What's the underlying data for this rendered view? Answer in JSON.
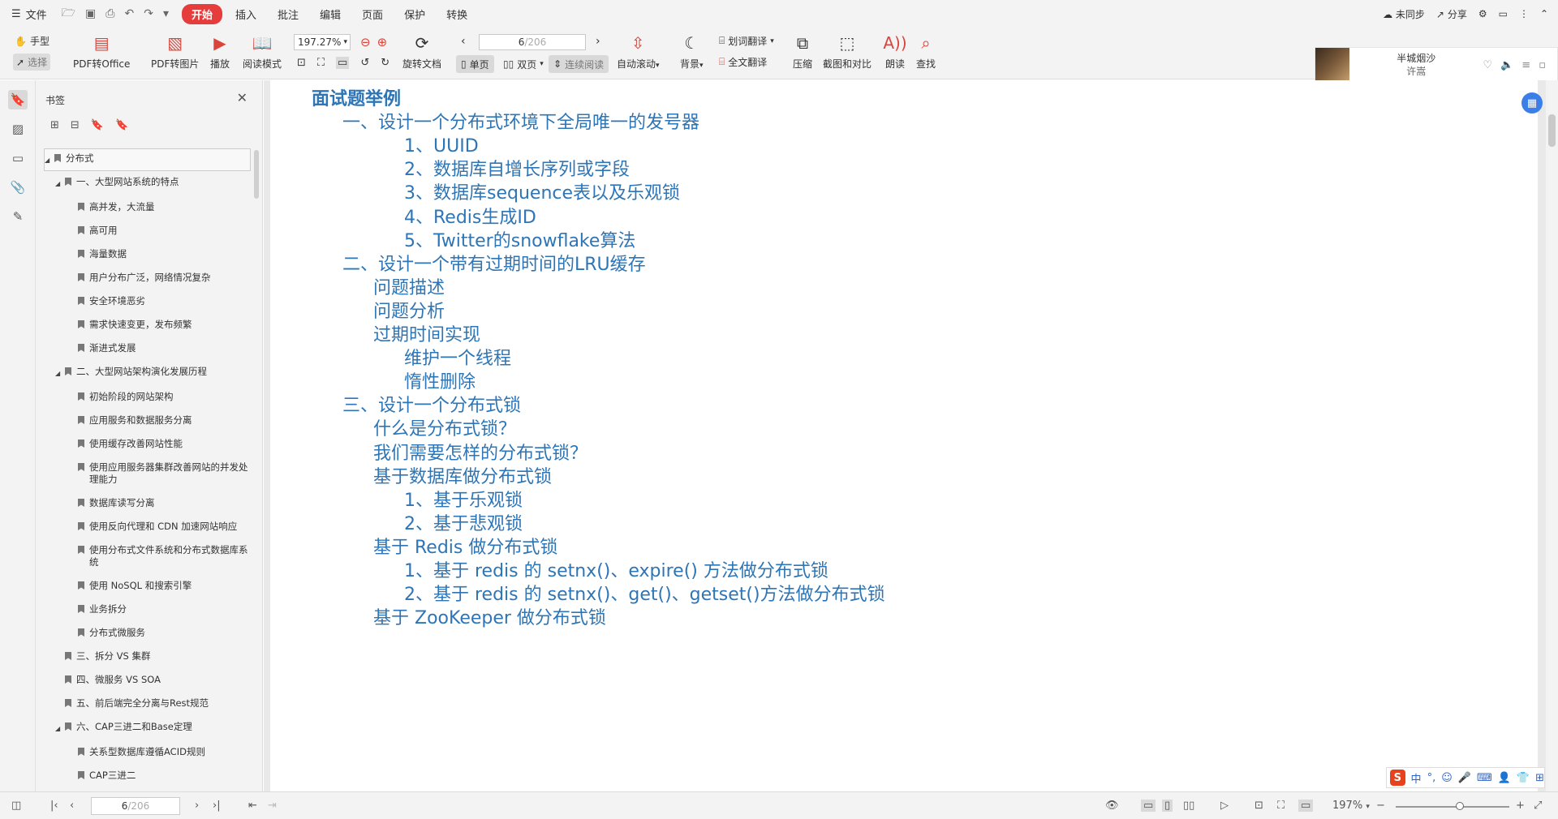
{
  "menubar": {
    "file_label": "文件",
    "tabs": [
      "开始",
      "插入",
      "批注",
      "编辑",
      "页面",
      "保护",
      "转换"
    ],
    "sync_label": "未同步",
    "share_label": "分享"
  },
  "toolbar": {
    "hand_label": "手型",
    "select_label": "选择",
    "pdf_to_office": "PDF转Office",
    "pdf_to_image": "PDF转图片",
    "play": "播放",
    "read_mode": "阅读模式",
    "zoom_value": "197.27%",
    "rotate_doc": "旋转文档",
    "page_current": "6",
    "page_total": "/206",
    "single_page": "单页",
    "double_page": "双页",
    "continuous": "连续阅读",
    "auto_scroll": "自动滚动",
    "background": "背景",
    "word_translate": "划词翻译",
    "full_translate": "全文翻译",
    "compress": "压缩",
    "screenshot_compare": "截图和对比",
    "read_aloud": "朗读",
    "find": "查找"
  },
  "music": {
    "song": "半城烟沙",
    "artist": "许嵩"
  },
  "bookmark_panel": {
    "title": "书签",
    "items": [
      {
        "level": "root",
        "expand": "◢",
        "label": "分布式"
      },
      {
        "level": "1",
        "expand": "◢",
        "label": "一、大型网站系统的特点"
      },
      {
        "level": "2",
        "expand": "",
        "label": "高并发，大流量"
      },
      {
        "level": "2",
        "expand": "",
        "label": "高可用"
      },
      {
        "level": "2",
        "expand": "",
        "label": "海量数据"
      },
      {
        "level": "2",
        "expand": "",
        "label": "用户分布广泛，网络情况复杂"
      },
      {
        "level": "2",
        "expand": "",
        "label": "安全环境恶劣"
      },
      {
        "level": "2",
        "expand": "",
        "label": "需求快速变更，发布频繁"
      },
      {
        "level": "2",
        "expand": "",
        "label": "渐进式发展"
      },
      {
        "level": "1",
        "expand": "◢",
        "label": "二、大型网站架构演化发展历程"
      },
      {
        "level": "2",
        "expand": "",
        "label": "初始阶段的网站架构"
      },
      {
        "level": "2",
        "expand": "",
        "label": "应用服务和数据服务分离"
      },
      {
        "level": "2",
        "expand": "",
        "label": "使用缓存改善网站性能"
      },
      {
        "level": "2",
        "expand": "",
        "label": "使用应用服务器集群改善网站的并发处理能力"
      },
      {
        "level": "2",
        "expand": "",
        "label": "数据库读写分离"
      },
      {
        "level": "2",
        "expand": "",
        "label": "使用反向代理和 CDN 加速网站响应"
      },
      {
        "level": "2",
        "expand": "",
        "label": "使用分布式文件系统和分布式数据库系统"
      },
      {
        "level": "2",
        "expand": "",
        "label": "使用 NoSQL 和搜索引擎"
      },
      {
        "level": "2",
        "expand": "",
        "label": "业务拆分"
      },
      {
        "level": "2",
        "expand": "",
        "label": "分布式微服务"
      },
      {
        "level": "1",
        "expand": "",
        "label": "三、拆分 VS 集群"
      },
      {
        "level": "1",
        "expand": "",
        "label": "四、微服务 VS SOA"
      },
      {
        "level": "1",
        "expand": "",
        "label": "五、前后端完全分离与Rest规范"
      },
      {
        "level": "1",
        "expand": "◢",
        "label": "六、CAP三进二和Base定理"
      },
      {
        "level": "2",
        "expand": "",
        "label": "关系型数据库遵循ACID规则"
      },
      {
        "level": "2",
        "expand": "",
        "label": "CAP三进二"
      }
    ]
  },
  "document": {
    "lines": [
      {
        "cls": "h",
        "indent": 0,
        "text": "面试题举例"
      },
      {
        "cls": "",
        "indent": 1,
        "text": "一、设计一个分布式环境下全局唯一的发号器"
      },
      {
        "cls": "",
        "indent": 3,
        "text": "1、UUID"
      },
      {
        "cls": "",
        "indent": 3,
        "text": "2、数据库自增长序列或字段"
      },
      {
        "cls": "",
        "indent": 3,
        "text": "3、数据库sequence表以及乐观锁"
      },
      {
        "cls": "",
        "indent": 3,
        "text": "4、Redis生成ID"
      },
      {
        "cls": "",
        "indent": 3,
        "text": "5、Twitter的snowflake算法"
      },
      {
        "cls": "",
        "indent": 1,
        "text": "二、设计一个带有过期时间的LRU缓存"
      },
      {
        "cls": "",
        "indent": 2,
        "text": "问题描述"
      },
      {
        "cls": "",
        "indent": 2,
        "text": "问题分析"
      },
      {
        "cls": "",
        "indent": 2,
        "text": "过期时间实现"
      },
      {
        "cls": "",
        "indent": 3,
        "text": "维护一个线程"
      },
      {
        "cls": "",
        "indent": 3,
        "text": "惰性删除"
      },
      {
        "cls": "",
        "indent": 1,
        "text": "三、设计一个分布式锁"
      },
      {
        "cls": "",
        "indent": 2,
        "text": "什么是分布式锁？"
      },
      {
        "cls": "",
        "indent": 2,
        "text": "我们需要怎样的分布式锁？"
      },
      {
        "cls": "",
        "indent": 2,
        "text": "基于数据库做分布式锁"
      },
      {
        "cls": "",
        "indent": 3,
        "text": "1、基于乐观锁"
      },
      {
        "cls": "",
        "indent": 3,
        "text": "2、基于悲观锁"
      },
      {
        "cls": "",
        "indent": 2,
        "text": "基于 Redis 做分布式锁"
      },
      {
        "cls": "",
        "indent": 3,
        "text": "1、基于 redis 的 setnx()、expire() 方法做分布式锁"
      },
      {
        "cls": "",
        "indent": 3,
        "text": "2、基于 redis 的 setnx()、get()、getset()方法做分布式锁"
      },
      {
        "cls": "",
        "indent": 2,
        "text": "基于 ZooKeeper 做分布式锁"
      }
    ]
  },
  "ime": {
    "logo": "S",
    "lang": "中"
  },
  "statusbar": {
    "page_current": "6",
    "page_total": "/206",
    "zoom": "197%"
  },
  "colors": {
    "accent_red": "#e63c3c",
    "doc_text_blue": "#2e75b6"
  }
}
